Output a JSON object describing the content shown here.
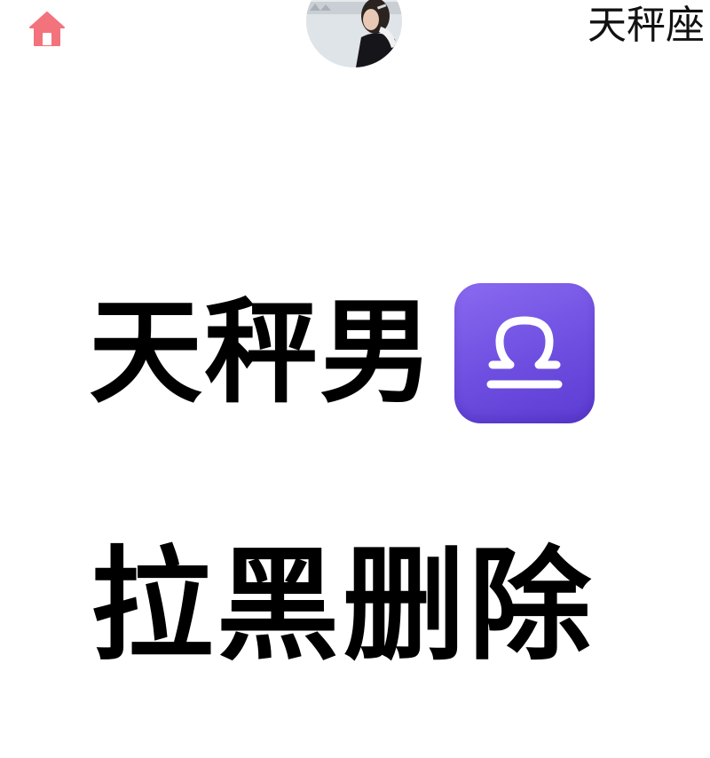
{
  "header": {
    "home_icon": "home-icon",
    "home_icon_color": "#f2737c",
    "avatar_icon": "profile-avatar",
    "top_label": "天秤座"
  },
  "content": {
    "headline": "天秤男",
    "emoji": "libra-emoji",
    "emoji_color": "#7454e6",
    "action_text": "拉黑删除"
  }
}
